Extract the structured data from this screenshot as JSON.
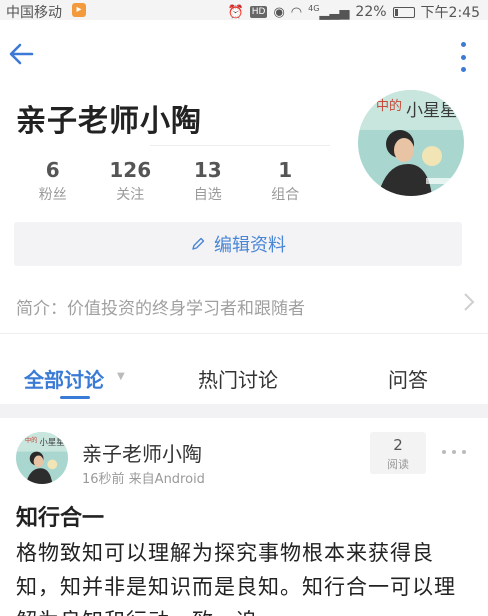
{
  "status_bar": {
    "carrier": "中国移动",
    "hd": "HD",
    "network": "4G",
    "battery_percent": "22%",
    "battery_level": 0.22,
    "time": "下午2:45"
  },
  "app_bar": {
    "back_icon": "arrow-left-icon",
    "more_icon": "more-vertical-icon",
    "accent_color": "#3d7ad6"
  },
  "profile": {
    "name": "亲子老师小陶",
    "stats": [
      {
        "value": "6",
        "label": "粉丝"
      },
      {
        "value": "126",
        "label": "关注"
      },
      {
        "value": "13",
        "label": "自选"
      },
      {
        "value": "1",
        "label": "组合"
      }
    ],
    "edit_button": "编辑资料",
    "bio": "简介：价值投资的终身学习者和跟随者"
  },
  "tabs": [
    {
      "label": "全部讨论",
      "active": true
    },
    {
      "label": "热门讨论",
      "active": false
    },
    {
      "label": "问答",
      "active": false
    }
  ],
  "post": {
    "author": "亲子老师小陶",
    "meta": "16秒前 来自Android",
    "read_count": "2",
    "read_label": "阅读",
    "title": "知行合一",
    "body": "格物致知可以理解为探究事物根本来获得良知，知并非是知识而是良知。知行合一可以理解为良知和行动一致，追..."
  }
}
